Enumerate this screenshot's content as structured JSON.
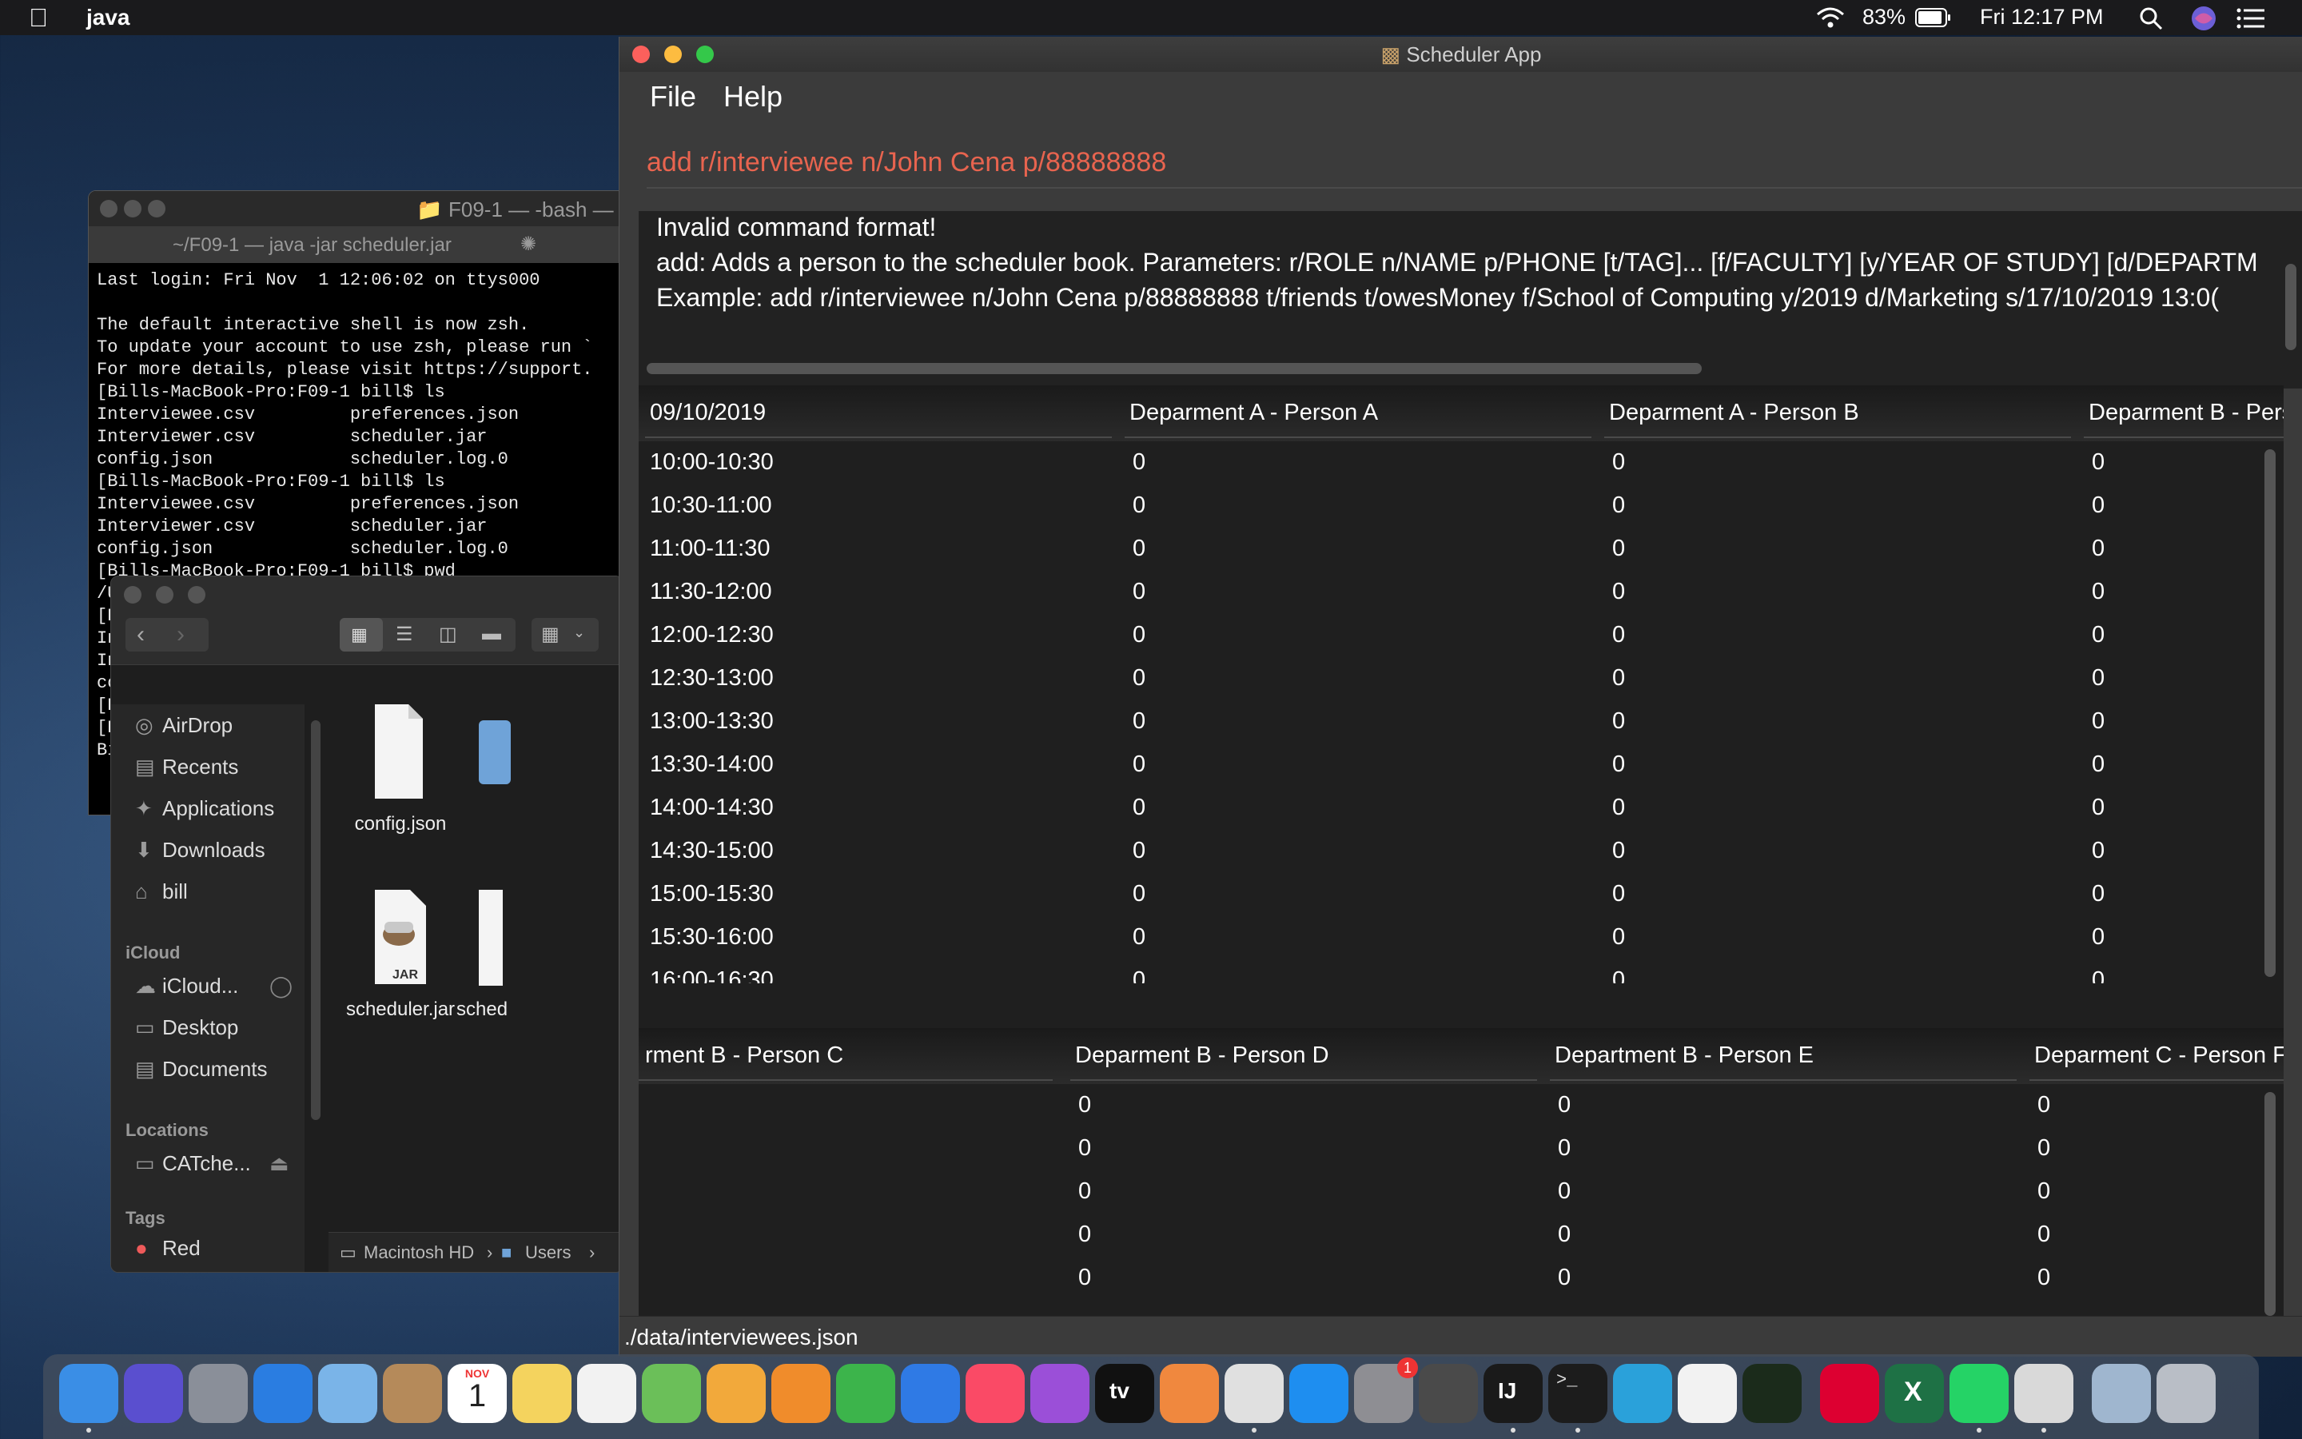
{
  "menubar": {
    "app_name": "java",
    "battery": "83%",
    "clock": "Fri 12:17 PM"
  },
  "terminal": {
    "title": "F09-1 — -bash —",
    "tab_title": "~/F09-1 — java -jar scheduler.jar",
    "lines": "Last login: Fri Nov  1 12:06:02 on ttys000\n\nThe default interactive shell is now zsh.\nTo update your account to use zsh, please run `\nFor more details, please visit https://support.\n[Bills-MacBook-Pro:F09-1 bill$ ls\nInterviewee.csv         preferences.json\nInterviewer.csv         scheduler.jar\nconfig.json             scheduler.log.0\n[Bills-MacBook-Pro:F09-1 bill$ ls\nInterviewee.csv         preferences.json\nInterviewer.csv         scheduler.jar\nconfig.json             scheduler.log.0\n[Bills-MacBook-Pro:F09-1 bill$ pwd\n/U\n[Bi\nIn\nIn\nco\n[Bi\n[Bi\nBi"
  },
  "finder": {
    "sidebar": {
      "items": [
        "AirDrop",
        "Recents",
        "Applications",
        "Downloads",
        "bill"
      ],
      "icloud_header": "iCloud",
      "icloud_items": [
        "iCloud...",
        "Desktop",
        "Documents"
      ],
      "locations_header": "Locations",
      "locations_items": [
        "CATche..."
      ],
      "tags_header": "Tags",
      "tags_items": [
        "Red"
      ]
    },
    "files": [
      "config.json",
      "scheduler.jar",
      "sched"
    ],
    "jar_badge": "JAR",
    "path": [
      "Macintosh HD",
      "Users"
    ]
  },
  "app": {
    "title": "Scheduler App",
    "menu": [
      "File",
      "Help"
    ],
    "command_value": "add r/interviewee n/John Cena p/88888888",
    "result_lines": [
      "Invalid command format!",
      "add: Adds a person to the scheduler book. Parameters: r/ROLE n/NAME p/PHONE [t/TAG]... [f/FACULTY] [y/YEAR OF STUDY] [d/DEPARTM",
      "Example: add r/interviewee n/John Cena p/88888888 t/friends t/owesMoney f/School of Computing y/2019 d/Marketing s/17/10/2019 13:0("
    ],
    "table1": {
      "headers": [
        "09/10/2019",
        "Deparment A - Person A",
        "Deparment A - Person B",
        "Deparment B - Pers"
      ],
      "rows": [
        [
          "10:00-10:30",
          "0",
          "0",
          "0"
        ],
        [
          "10:30-11:00",
          "0",
          "0",
          "0"
        ],
        [
          "11:00-11:30",
          "0",
          "0",
          "0"
        ],
        [
          "11:30-12:00",
          "0",
          "0",
          "0"
        ],
        [
          "12:00-12:30",
          "0",
          "0",
          "0"
        ],
        [
          "12:30-13:00",
          "0",
          "0",
          "0"
        ],
        [
          "13:00-13:30",
          "0",
          "0",
          "0"
        ],
        [
          "13:30-14:00",
          "0",
          "0",
          "0"
        ],
        [
          "14:00-14:30",
          "0",
          "0",
          "0"
        ],
        [
          "14:30-15:00",
          "0",
          "0",
          "0"
        ],
        [
          "15:00-15:30",
          "0",
          "0",
          "0"
        ],
        [
          "15:30-16:00",
          "0",
          "0",
          "0"
        ],
        [
          "16:00-16:30",
          "0",
          "0",
          "0"
        ]
      ]
    },
    "table2": {
      "headers": [
        "rment B - Person C",
        "Deparment B - Person D",
        "Department B - Person E",
        "Deparment C - Person F"
      ],
      "rows": [
        [
          "",
          "0",
          "0",
          "0"
        ],
        [
          "",
          "0",
          "0",
          "0"
        ],
        [
          "",
          "0",
          "0",
          "0"
        ],
        [
          "",
          "0",
          "0",
          "0"
        ],
        [
          "",
          "0",
          "0",
          "0"
        ]
      ]
    },
    "status_path": "./data/interviewees.json"
  },
  "dock": {
    "calendar_month": "NOV",
    "calendar_day": "1",
    "settings_badge": "1",
    "intellij_label": "IJ",
    "terminal_label": ">_",
    "excel_label": "X",
    "appletv_label": "tv",
    "icons": [
      {
        "name": "finder-icon",
        "color": "#3a8ee6"
      },
      {
        "name": "siri-icon",
        "color": "#5a4fcf"
      },
      {
        "name": "launchpad-icon",
        "color": "#8a8f99"
      },
      {
        "name": "safari-icon",
        "color": "#2a7de1"
      },
      {
        "name": "mail-icon",
        "color": "#7ab4e8"
      },
      {
        "name": "contacts-icon",
        "color": "#b58a5a"
      },
      {
        "name": "calendar-icon",
        "color": "#ffffff"
      },
      {
        "name": "notes-icon",
        "color": "#f4d35e"
      },
      {
        "name": "reminders-icon",
        "color": "#f2f2f2"
      },
      {
        "name": "maps-icon",
        "color": "#6bbf59"
      },
      {
        "name": "photos-icon",
        "color": "#f2a93b"
      },
      {
        "name": "pages-icon",
        "color": "#f08c2b"
      },
      {
        "name": "numbers-icon",
        "color": "#3cb44b"
      },
      {
        "name": "keynote-icon",
        "color": "#2f7ae5"
      },
      {
        "name": "music-icon",
        "color": "#fa4a66"
      },
      {
        "name": "podcasts-icon",
        "color": "#9b4fd8"
      },
      {
        "name": "appletv-icon",
        "color": "#111111"
      },
      {
        "name": "handmirror-icon",
        "color": "#f0883e"
      },
      {
        "name": "chrome-icon",
        "color": "#e0e0e0"
      },
      {
        "name": "appstore-icon",
        "color": "#1e8ef0"
      },
      {
        "name": "systempreferences-icon",
        "color": "#8e8e93"
      },
      {
        "name": "pliers-icon",
        "color": "#4a4a4a"
      },
      {
        "name": "intellij-icon",
        "color": "#1a1a1a"
      },
      {
        "name": "terminal-icon",
        "color": "#1c1c1c"
      },
      {
        "name": "telegram-icon",
        "color": "#2aa1da"
      },
      {
        "name": "slack-icon",
        "color": "#f2f2f2"
      },
      {
        "name": "activitymonitor-icon",
        "color": "#1b2b1b"
      },
      {
        "name": "angular-icon",
        "color": "#dd0031"
      },
      {
        "name": "excel-icon",
        "color": "#1e7145"
      },
      {
        "name": "whatsapp-icon",
        "color": "#25d366"
      },
      {
        "name": "java-icon",
        "color": "#d9d9d9"
      },
      {
        "name": "downloads-stack-icon",
        "color": "#9fb6cf"
      },
      {
        "name": "trash-icon",
        "color": "#b9bec6"
      }
    ]
  }
}
